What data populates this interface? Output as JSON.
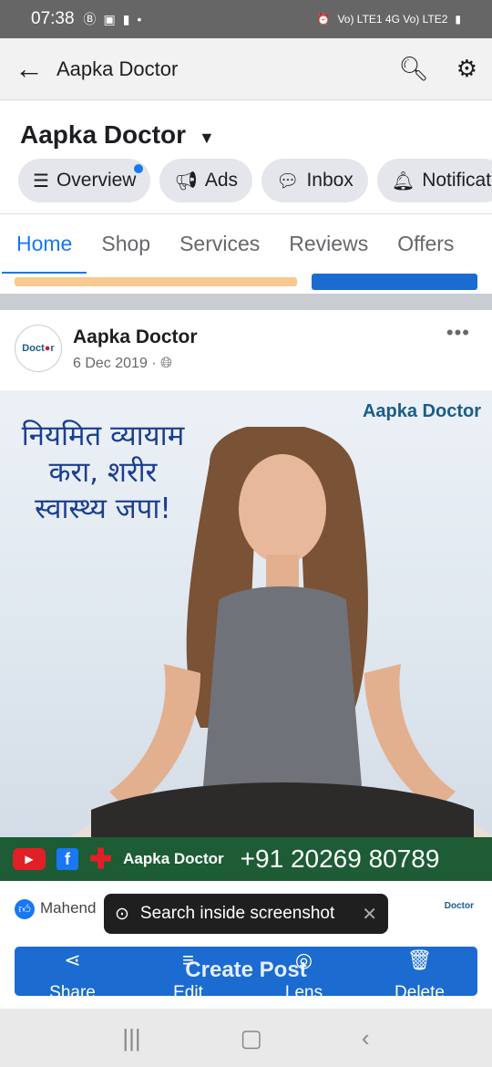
{
  "status_bar": {
    "time": "07:38",
    "left_icons": [
      "b-icon",
      "image-icon",
      "flashlight-icon",
      "dot-icon"
    ],
    "right_text": "Vo) LTE1 4G Vo) LTE2"
  },
  "appbar": {
    "title": "Aapka Doctor"
  },
  "page": {
    "name": "Aapka Doctor"
  },
  "chips": [
    {
      "label": "Overview",
      "icon": "list-icon"
    },
    {
      "label": "Ads",
      "icon": "megaphone-icon"
    },
    {
      "label": "Inbox",
      "icon": "chat-icon"
    },
    {
      "label": "Notificat",
      "icon": "bell-icon"
    }
  ],
  "tabs": [
    "Home",
    "Shop",
    "Services",
    "Reviews",
    "Offers"
  ],
  "post": {
    "author": "Aapka Doctor",
    "date": "6 Dec 2019",
    "hindi_text": "नियमित व्यायाम करा, शरीर स्वास्थ्य जपा!",
    "brand": "Aapka Doctor",
    "banner_name": "Aapka Doctor",
    "banner_phone": "+91 20269 80789",
    "reaction_names": "Mahend"
  },
  "toast": {
    "text": "Search inside screenshot"
  },
  "action_bar": {
    "create_label": "Create Post",
    "actions": [
      {
        "label": "Share",
        "icon": "share-icon"
      },
      {
        "label": "Edit",
        "icon": "edit-icon"
      },
      {
        "label": "Lens",
        "icon": "lens-icon"
      },
      {
        "label": "Delete",
        "icon": "delete-icon"
      }
    ]
  },
  "colors": {
    "accent": "#1877f2",
    "banner": "#1d5c35",
    "status_bar": "#666666"
  }
}
